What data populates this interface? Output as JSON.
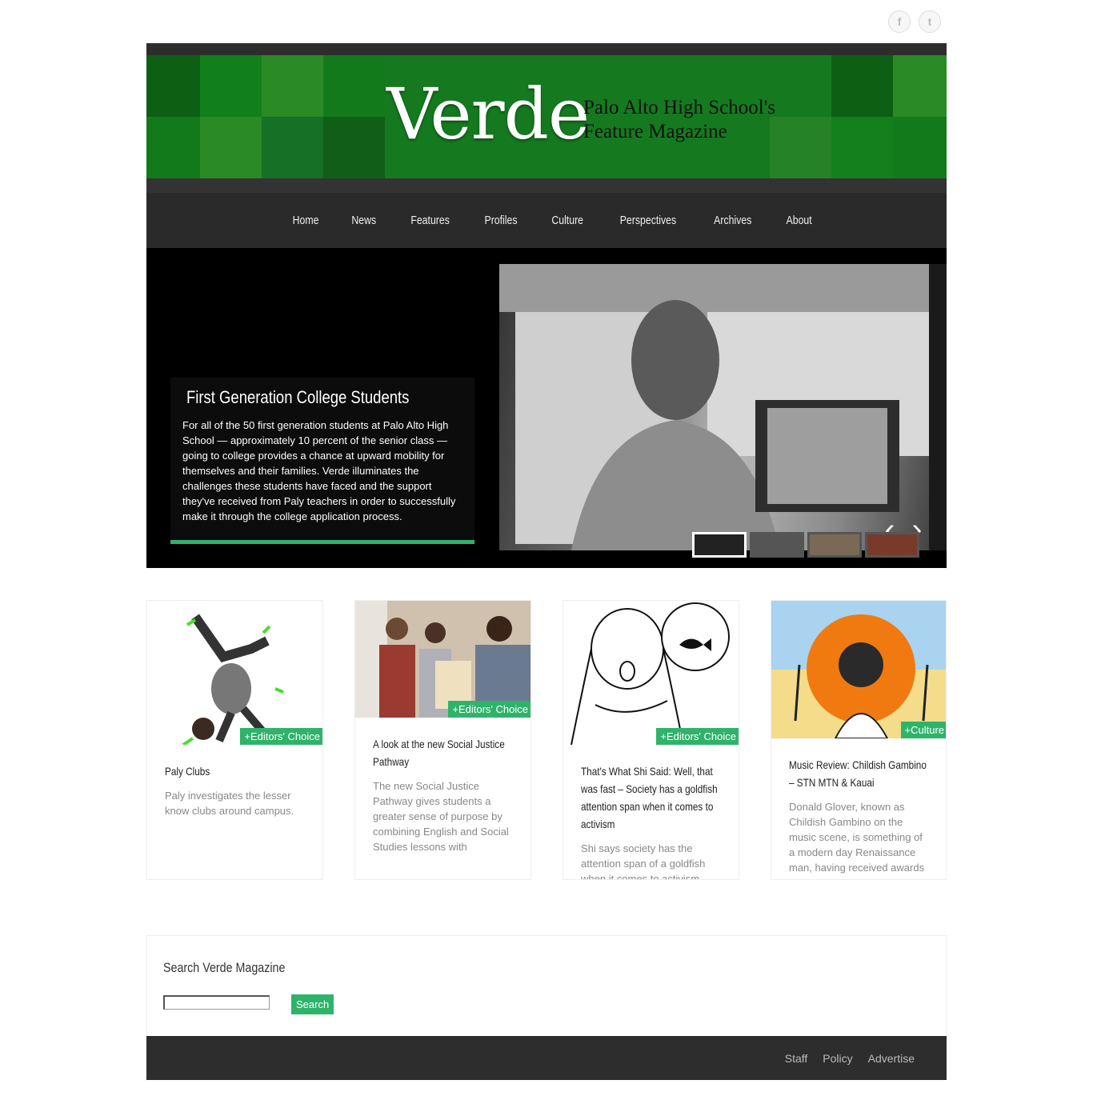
{
  "social": {
    "facebook_glyph": "f",
    "twitter_glyph": "t"
  },
  "header": {
    "logo": "Verde",
    "tagline_line1": "Palo Alto High School's",
    "tagline_line2": "Feature Magazine",
    "brand_color": "#157a1f"
  },
  "nav": {
    "items": [
      "Home",
      "News",
      "Features",
      "Profiles",
      "Culture",
      "Perspectives",
      "Archives",
      "About"
    ]
  },
  "slider": {
    "title": "First Generation College Students",
    "text": "For all of the 50 first generation students at Palo Alto High School — approximately 10 percent of the senior class — going to college provides a chance at upward mobility for themselves and their families. Verde illuminates the challenges these students have faced and the support they've received from Paly teachers in order to successfully make it through the college application process.",
    "prev_glyph": "‹",
    "next_glyph": "›",
    "accent_color": "#2fb36b"
  },
  "cards": [
    {
      "tag": "+Editors' Choice",
      "title": "Paly Clubs",
      "excerpt": "Paly investigates the lesser know clubs around campus."
    },
    {
      "tag": "+Editors' Choice",
      "title": "A look at the new Social Justice Pathway",
      "excerpt": "The new Social Justice Pathway gives students a greater sense of purpose by combining English and Social Studies lessons with"
    },
    {
      "tag": "+Editors' Choice",
      "title": "That's What Shi Said: Well, that was fast – Society has a goldfish attention span when it comes to activism",
      "excerpt": "Shi says society has the attention span of a goldfish when it comes to activism"
    },
    {
      "tag": "+Culture",
      "title": "Music Review: Childish Gambino – STN MTN & Kauai",
      "excerpt": "Donald Glover, known as Childish Gambino on the music scene, is something of a modern day Renaissance man, having received awards"
    }
  ],
  "search": {
    "heading": "Search Verde Magazine",
    "button": "Search",
    "placeholder": ""
  },
  "footer": {
    "links": [
      "Staff",
      "Policy",
      "Advertise"
    ]
  }
}
